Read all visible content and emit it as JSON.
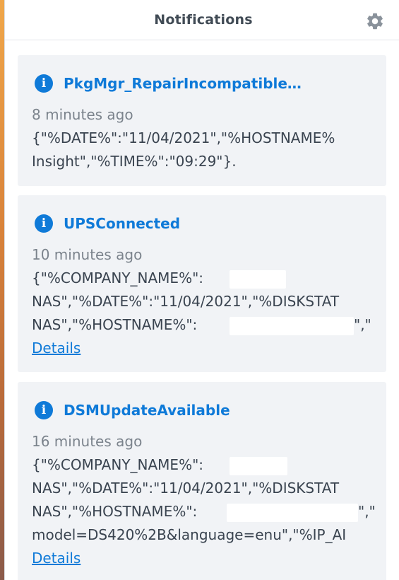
{
  "header": {
    "title": "Notifications",
    "settings_icon": "gear-icon"
  },
  "notifications": [
    {
      "title": "PkgMgr_RepairIncompatible…",
      "time": "8 minutes ago",
      "lines": [
        "{\"%DATE%\":\"11/04/2021\",\"%HOSTNAME%",
        "Insight\",\"%TIME%\":\"09:29\"}."
      ]
    },
    {
      "title": "UPSConnected",
      "time": "10 minutes ago",
      "lines": [
        "{\"%COMPANY_NAME%\":",
        "NAS\",\"%DATE%\":\"11/04/2021\",\"%DISKSTAT",
        "NAS\",\"%HOSTNAME%\":",
        "\",\""
      ],
      "link": "Details"
    },
    {
      "title": "DSMUpdateAvailable",
      "time": "16 minutes ago",
      "lines": [
        "{\"%COMPANY_NAME%\":",
        "NAS\",\"%DATE%\":\"11/04/2021\",\"%DISKSTAT",
        "NAS\",\"%HOSTNAME%\":",
        "\",\"",
        "model=DS420%2B&language=enu\",\"%IP_AI"
      ],
      "link": "Details"
    }
  ],
  "colors": {
    "accent": "#0f7ad8",
    "card_bg": "#f1f3f6",
    "muted": "#7b838c",
    "text": "#3a4450"
  }
}
